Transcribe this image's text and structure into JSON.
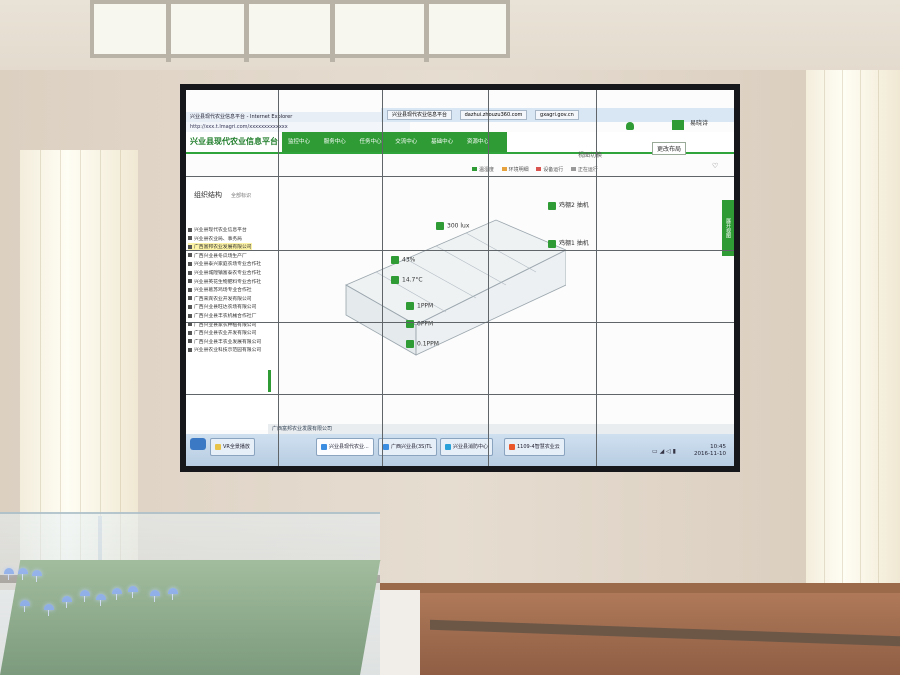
{
  "window": {
    "title": "兴业县现代农业信息平台 - Internet Explorer",
    "address": "http://xxx.t.lmagri.com/xxxxxxxxxxxxx",
    "tabs": [
      "兴业县现代农业信息平台",
      "dazhui.zhouzu360.com",
      "gxagri.gov.cn"
    ]
  },
  "site": {
    "logo": "兴业县现代农业信息平台",
    "nav": [
      "监控中心",
      "服务中心",
      "任务中心",
      "交流中心",
      "基础中心",
      "资源中心"
    ],
    "user": "易晓诗",
    "top_buttons": [
      "视图切换",
      "更改布局"
    ]
  },
  "legend": [
    "温湿度",
    "环境明细",
    "设备运行",
    "正在运行"
  ],
  "sidebar": {
    "title": "组织结构",
    "link": "全部标识",
    "tree": [
      "兴业县现代农业信息平台",
      "兴业县农业局、事务局",
      "广西富邦农业发展有限公司",
      "广西兴业县冬瓜场生产厂",
      "兴业县泰兴家庭农场专业合作社",
      "兴业县城隍镇富泰农专业合作社",
      "兴业县英花生物肥料专业合作社",
      "兴业县葛苏鸡场专业合作社",
      "广西来宾农业开发有限公司",
      "广西兴业县旺达农场有限公司",
      "广西兴业县丰农机械合作社厂",
      "广西兴业县家农种植有限公司",
      "广西兴业县农业开发有限公司",
      "广西兴业县丰农业发展有限公司",
      "兴业县农业科技示范园有限公司"
    ],
    "selected_index": 2
  },
  "sensors": {
    "light": "300 lux",
    "humidity": "43%",
    "temperature": "14.7°C",
    "gas1": "1PPM",
    "gas2": "0PPM",
    "gas3": "0.1PPM",
    "device1": "鸡棚2 抽机",
    "device2": "鸡棚1 抽机"
  },
  "side_tab": "展开视图",
  "status_bar": "广西富邦农业发展有限公司",
  "taskbar": {
    "items": [
      "VR全景播放",
      "兴业县现代农业...",
      "广西兴业县(3S)TL",
      "兴业县消防中心",
      "1109-4智慧农业云"
    ],
    "time": "10:45",
    "date": "2016-11-10"
  },
  "colors": {
    "brand_green": "#2e9b35",
    "selected_item": "#fdf3a6",
    "taskbar": "#c4d6ea"
  },
  "icons": [
    "bell-icon",
    "user-icon",
    "heart-icon",
    "windows-start-icon"
  ]
}
